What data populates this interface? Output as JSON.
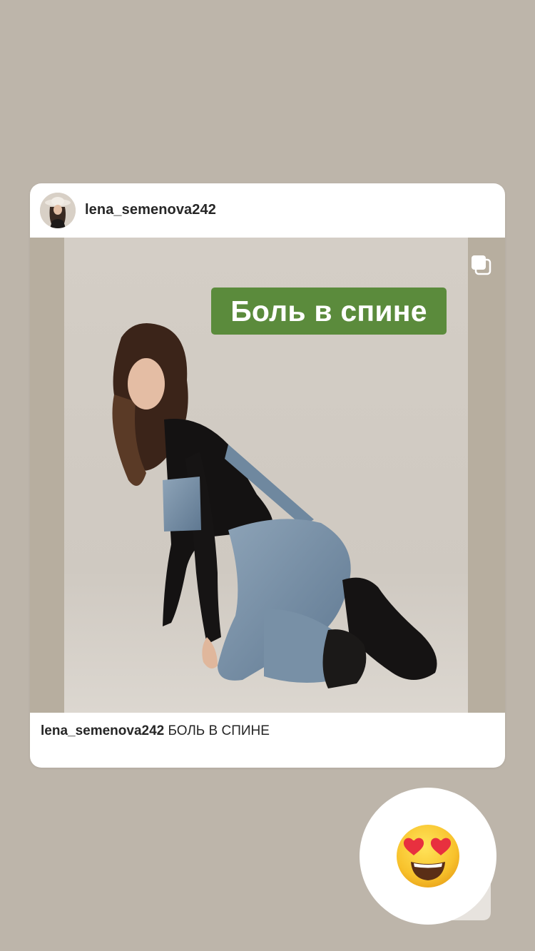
{
  "post": {
    "username": "lena_semenova242",
    "overlay_text": "Боль в спине",
    "caption_user": "lena_semenova242",
    "caption_text": "БОЛЬ В СПИНЕ"
  },
  "reaction": {
    "emoji": "😍"
  },
  "colors": {
    "background": "#bdb5aa",
    "label_green": "#5b8b3c",
    "card": "#ffffff",
    "text": "#262626"
  },
  "icons": [
    "multi-image-icon",
    "heart-eyes-emoji",
    "avatar"
  ]
}
